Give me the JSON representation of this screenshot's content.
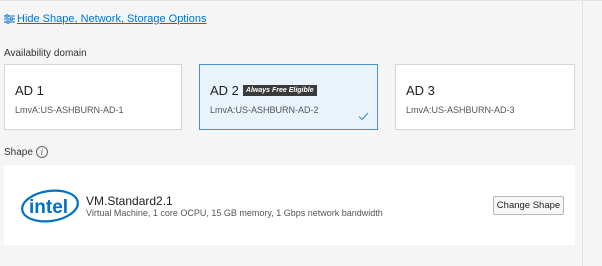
{
  "toggle": {
    "label": "Hide Shape, Network, Storage Options",
    "icon": "sliders-icon"
  },
  "availability_domain": {
    "label": "Availability domain",
    "cards": [
      {
        "name": "AD 1",
        "id": "LmvA:US-ASHBURN-AD-1",
        "badge": "",
        "selected": false
      },
      {
        "name": "AD 2",
        "id": "LmvA:US-ASHBURN-AD-2",
        "badge": "Always Free Eligible",
        "selected": true
      },
      {
        "name": "AD 3",
        "id": "LmvA:US-ASHBURN-AD-3",
        "badge": "",
        "selected": false
      }
    ]
  },
  "shape": {
    "label": "Shape",
    "logo_text": "intel",
    "name": "VM.Standard2.1",
    "description": "Virtual Machine, 1 core OCPU, 15 GB memory, 1 Gbps network bandwidth",
    "change_button": "Change Shape"
  },
  "colors": {
    "link": "#0572ce",
    "selected_bg": "#e9f3fc",
    "selected_border": "#4a90d9",
    "intel_blue": "#0071c5",
    "badge_bg": "#3a3a3a"
  }
}
